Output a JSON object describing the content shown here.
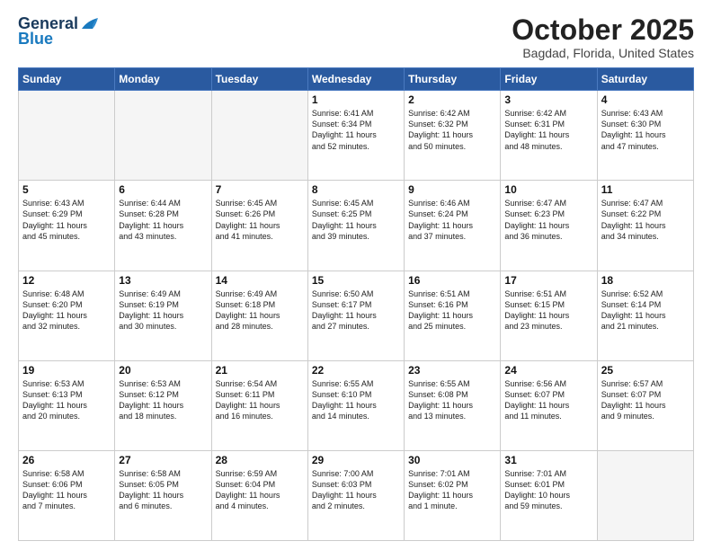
{
  "header": {
    "logo_general": "General",
    "logo_blue": "Blue",
    "month_title": "October 2025",
    "location": "Bagdad, Florida, United States"
  },
  "days_of_week": [
    "Sunday",
    "Monday",
    "Tuesday",
    "Wednesday",
    "Thursday",
    "Friday",
    "Saturday"
  ],
  "weeks": [
    [
      {
        "day": "",
        "empty": true
      },
      {
        "day": "",
        "empty": true
      },
      {
        "day": "",
        "empty": true
      },
      {
        "day": "1",
        "lines": [
          "Sunrise: 6:41 AM",
          "Sunset: 6:34 PM",
          "Daylight: 11 hours",
          "and 52 minutes."
        ]
      },
      {
        "day": "2",
        "lines": [
          "Sunrise: 6:42 AM",
          "Sunset: 6:32 PM",
          "Daylight: 11 hours",
          "and 50 minutes."
        ]
      },
      {
        "day": "3",
        "lines": [
          "Sunrise: 6:42 AM",
          "Sunset: 6:31 PM",
          "Daylight: 11 hours",
          "and 48 minutes."
        ]
      },
      {
        "day": "4",
        "lines": [
          "Sunrise: 6:43 AM",
          "Sunset: 6:30 PM",
          "Daylight: 11 hours",
          "and 47 minutes."
        ]
      }
    ],
    [
      {
        "day": "5",
        "lines": [
          "Sunrise: 6:43 AM",
          "Sunset: 6:29 PM",
          "Daylight: 11 hours",
          "and 45 minutes."
        ]
      },
      {
        "day": "6",
        "lines": [
          "Sunrise: 6:44 AM",
          "Sunset: 6:28 PM",
          "Daylight: 11 hours",
          "and 43 minutes."
        ]
      },
      {
        "day": "7",
        "lines": [
          "Sunrise: 6:45 AM",
          "Sunset: 6:26 PM",
          "Daylight: 11 hours",
          "and 41 minutes."
        ]
      },
      {
        "day": "8",
        "lines": [
          "Sunrise: 6:45 AM",
          "Sunset: 6:25 PM",
          "Daylight: 11 hours",
          "and 39 minutes."
        ]
      },
      {
        "day": "9",
        "lines": [
          "Sunrise: 6:46 AM",
          "Sunset: 6:24 PM",
          "Daylight: 11 hours",
          "and 37 minutes."
        ]
      },
      {
        "day": "10",
        "lines": [
          "Sunrise: 6:47 AM",
          "Sunset: 6:23 PM",
          "Daylight: 11 hours",
          "and 36 minutes."
        ]
      },
      {
        "day": "11",
        "lines": [
          "Sunrise: 6:47 AM",
          "Sunset: 6:22 PM",
          "Daylight: 11 hours",
          "and 34 minutes."
        ]
      }
    ],
    [
      {
        "day": "12",
        "lines": [
          "Sunrise: 6:48 AM",
          "Sunset: 6:20 PM",
          "Daylight: 11 hours",
          "and 32 minutes."
        ]
      },
      {
        "day": "13",
        "lines": [
          "Sunrise: 6:49 AM",
          "Sunset: 6:19 PM",
          "Daylight: 11 hours",
          "and 30 minutes."
        ]
      },
      {
        "day": "14",
        "lines": [
          "Sunrise: 6:49 AM",
          "Sunset: 6:18 PM",
          "Daylight: 11 hours",
          "and 28 minutes."
        ]
      },
      {
        "day": "15",
        "lines": [
          "Sunrise: 6:50 AM",
          "Sunset: 6:17 PM",
          "Daylight: 11 hours",
          "and 27 minutes."
        ]
      },
      {
        "day": "16",
        "lines": [
          "Sunrise: 6:51 AM",
          "Sunset: 6:16 PM",
          "Daylight: 11 hours",
          "and 25 minutes."
        ]
      },
      {
        "day": "17",
        "lines": [
          "Sunrise: 6:51 AM",
          "Sunset: 6:15 PM",
          "Daylight: 11 hours",
          "and 23 minutes."
        ]
      },
      {
        "day": "18",
        "lines": [
          "Sunrise: 6:52 AM",
          "Sunset: 6:14 PM",
          "Daylight: 11 hours",
          "and 21 minutes."
        ]
      }
    ],
    [
      {
        "day": "19",
        "lines": [
          "Sunrise: 6:53 AM",
          "Sunset: 6:13 PM",
          "Daylight: 11 hours",
          "and 20 minutes."
        ]
      },
      {
        "day": "20",
        "lines": [
          "Sunrise: 6:53 AM",
          "Sunset: 6:12 PM",
          "Daylight: 11 hours",
          "and 18 minutes."
        ]
      },
      {
        "day": "21",
        "lines": [
          "Sunrise: 6:54 AM",
          "Sunset: 6:11 PM",
          "Daylight: 11 hours",
          "and 16 minutes."
        ]
      },
      {
        "day": "22",
        "lines": [
          "Sunrise: 6:55 AM",
          "Sunset: 6:10 PM",
          "Daylight: 11 hours",
          "and 14 minutes."
        ]
      },
      {
        "day": "23",
        "lines": [
          "Sunrise: 6:55 AM",
          "Sunset: 6:08 PM",
          "Daylight: 11 hours",
          "and 13 minutes."
        ]
      },
      {
        "day": "24",
        "lines": [
          "Sunrise: 6:56 AM",
          "Sunset: 6:07 PM",
          "Daylight: 11 hours",
          "and 11 minutes."
        ]
      },
      {
        "day": "25",
        "lines": [
          "Sunrise: 6:57 AM",
          "Sunset: 6:07 PM",
          "Daylight: 11 hours",
          "and 9 minutes."
        ]
      }
    ],
    [
      {
        "day": "26",
        "lines": [
          "Sunrise: 6:58 AM",
          "Sunset: 6:06 PM",
          "Daylight: 11 hours",
          "and 7 minutes."
        ]
      },
      {
        "day": "27",
        "lines": [
          "Sunrise: 6:58 AM",
          "Sunset: 6:05 PM",
          "Daylight: 11 hours",
          "and 6 minutes."
        ]
      },
      {
        "day": "28",
        "lines": [
          "Sunrise: 6:59 AM",
          "Sunset: 6:04 PM",
          "Daylight: 11 hours",
          "and 4 minutes."
        ]
      },
      {
        "day": "29",
        "lines": [
          "Sunrise: 7:00 AM",
          "Sunset: 6:03 PM",
          "Daylight: 11 hours",
          "and 2 minutes."
        ]
      },
      {
        "day": "30",
        "lines": [
          "Sunrise: 7:01 AM",
          "Sunset: 6:02 PM",
          "Daylight: 11 hours",
          "and 1 minute."
        ]
      },
      {
        "day": "31",
        "lines": [
          "Sunrise: 7:01 AM",
          "Sunset: 6:01 PM",
          "Daylight: 10 hours",
          "and 59 minutes."
        ]
      },
      {
        "day": "",
        "empty": true
      }
    ]
  ]
}
